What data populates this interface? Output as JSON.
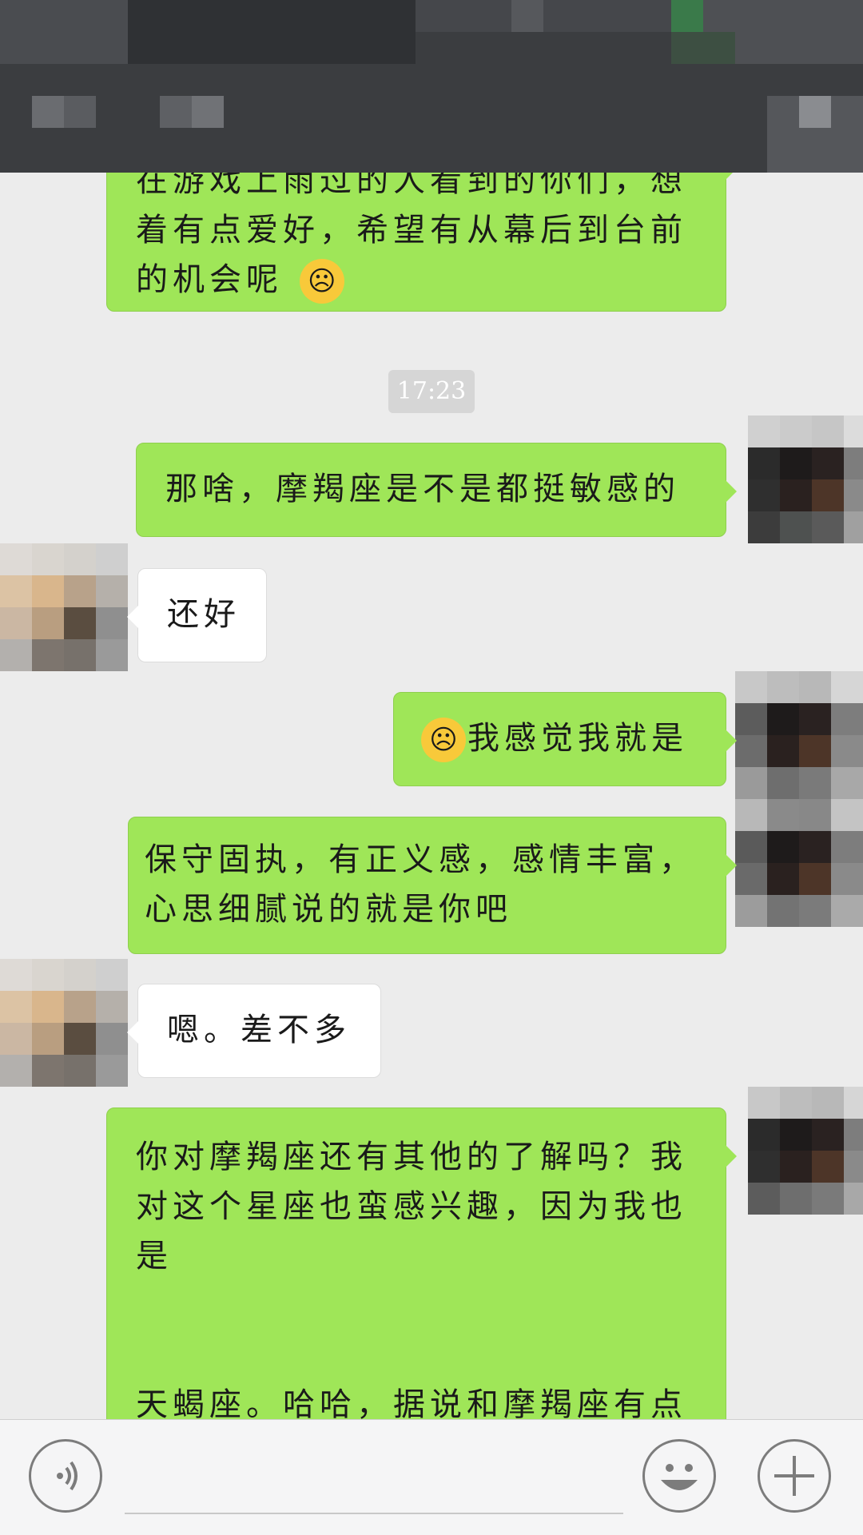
{
  "timestamp": "17:23",
  "messages": [
    {
      "side": "sent",
      "text": "在游戏上雨过的人看到的你们，想着有点爱好，希望有从幕后到台前的机会呢"
    },
    {
      "side": "sent",
      "text": "那啥，摩羯座是不是都挺敏感的"
    },
    {
      "side": "received",
      "text": "还好"
    },
    {
      "side": "sent",
      "text": "我感觉我就是"
    },
    {
      "side": "sent",
      "text": "保守固执，有正义感，感情丰富，心思细腻说的就是你吧"
    },
    {
      "side": "received",
      "text": "嗯。差不多"
    },
    {
      "side": "sent",
      "text": "你对摩羯座还有其他的了解吗？我对这个星座也蛮感兴趣，因为我也是"
    },
    {
      "side": "sent",
      "text": "天蝎座。哈哈，据说和摩羯座有点"
    }
  ],
  "icons": {
    "voice": "voice-icon",
    "emoji": "smiley-icon",
    "plus": "plus-icon",
    "facepalm": "facepalm-emoji"
  },
  "colors": {
    "sent_bubble": "#9fe658",
    "received_bubble": "#ffffff",
    "background": "#ececec"
  }
}
